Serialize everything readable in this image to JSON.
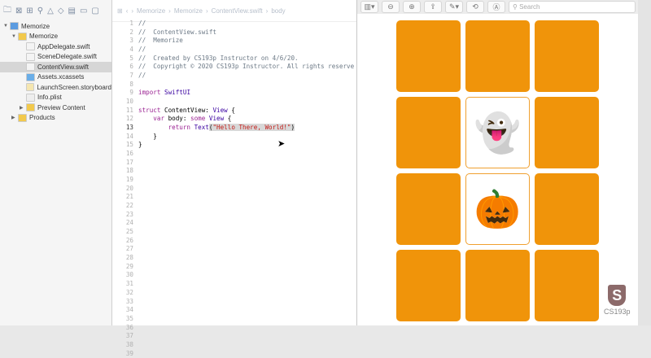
{
  "navigator": {
    "items": [
      {
        "label": "Memorize",
        "kind": "project",
        "indent": 0,
        "tri": "▼"
      },
      {
        "label": "Memorize",
        "kind": "folder",
        "indent": 1,
        "tri": "▼"
      },
      {
        "label": "AppDelegate.swift",
        "kind": "swift",
        "indent": 2
      },
      {
        "label": "SceneDelegate.swift",
        "kind": "swift",
        "indent": 2
      },
      {
        "label": "ContentView.swift",
        "kind": "swift",
        "indent": 2,
        "selected": true
      },
      {
        "label": "Assets.xcassets",
        "kind": "assets",
        "indent": 2
      },
      {
        "label": "LaunchScreen.storyboard",
        "kind": "storyboard",
        "indent": 2
      },
      {
        "label": "Info.plist",
        "kind": "plist",
        "indent": 2
      },
      {
        "label": "Preview Content",
        "kind": "folder",
        "indent": 2,
        "tri": "▶"
      },
      {
        "label": "Products",
        "kind": "folder",
        "indent": 1,
        "tri": "▶"
      }
    ]
  },
  "jumpbar": [
    "Memorize",
    "Memorize",
    "ContentView.swift",
    "body"
  ],
  "code": [
    "//",
    "//  ContentView.swift",
    "//  Memorize",
    "//",
    "//  Created by CS193p Instructor on 4/6/20.",
    "//  Copyright © 2020 CS193p Instructor. All rights reserve",
    "//",
    "",
    "import SwiftUI",
    "",
    "struct ContentView: View {",
    "    var body: some View {",
    "        return Text(\"Hello There, World!\")",
    "    }",
    "}"
  ],
  "line_count": 39,
  "current_line": 13,
  "preview": {
    "search_placeholder": "Search",
    "cards": [
      {
        "face_up": false
      },
      {
        "face_up": false
      },
      {
        "face_up": false
      },
      {
        "face_up": false
      },
      {
        "face_up": true,
        "emoji": "👻"
      },
      {
        "face_up": false
      },
      {
        "face_up": false
      },
      {
        "face_up": true,
        "emoji": "🎃"
      },
      {
        "face_up": false
      },
      {
        "face_up": false
      },
      {
        "face_up": false
      },
      {
        "face_up": false
      }
    ]
  },
  "logo": {
    "letter": "S",
    "text": "CS193p"
  },
  "colors": {
    "card": "#f0940a"
  }
}
